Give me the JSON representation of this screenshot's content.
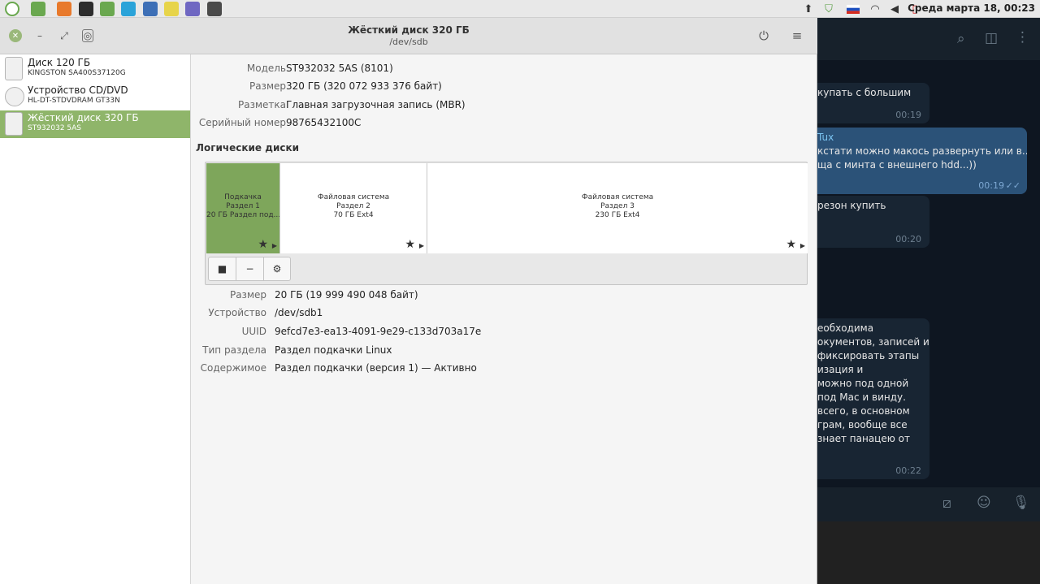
{
  "panel": {
    "clock": "Среда марта 18, 00:23",
    "launchers": [
      {
        "name": "menu-icon",
        "color": "#ffffff"
      },
      {
        "name": "files-icon",
        "color": "#6aa84f"
      },
      {
        "name": "firefox-icon",
        "color": "#e8792b"
      },
      {
        "name": "terminal-icon",
        "color": "#2d2d2d"
      },
      {
        "name": "folder-icon",
        "color": "#6aa84f"
      },
      {
        "name": "telegram-icon",
        "color": "#2aa3d9"
      },
      {
        "name": "camera-icon",
        "color": "#3d6fb6"
      },
      {
        "name": "notes-icon",
        "color": "#e7d44a"
      },
      {
        "name": "calendar-icon",
        "color": "#6f67c2"
      },
      {
        "name": "disks-icon",
        "color": "#4a4a4a"
      }
    ]
  },
  "window": {
    "title": "Жёсткий диск 320 ГБ",
    "subtitle": "/dev/sdb",
    "power_icon": "⏻",
    "menu_icon": "≡"
  },
  "sidebar": {
    "devices": [
      {
        "name": "Диск 120 ГБ",
        "sub": "KINGSTON SA400S37120G",
        "type": "disk"
      },
      {
        "name": "Устройство CD/DVD",
        "sub": "HL-DT-STDVDRAM GT33N",
        "type": "cd"
      },
      {
        "name": "Жёсткий диск 320 ГБ",
        "sub": "ST932032 5AS",
        "type": "disk"
      }
    ]
  },
  "disk": {
    "props": [
      {
        "key": "Модель",
        "value": "ST932032 5AS (8101)"
      },
      {
        "key": "Размер",
        "value": "320 ГБ (320 072 933 376 байт)"
      },
      {
        "key": "Разметка",
        "value": "Главная загрузочная запись (MBR)"
      },
      {
        "key": "Серийный номер",
        "value": "98765432100C"
      }
    ],
    "section": "Логические диски",
    "partitions": [
      {
        "line1": "Подкачка",
        "line2": "Раздел 1",
        "line3": "20 ГБ Раздел под..."
      },
      {
        "line1": "Файловая система",
        "line2": "Раздел 2",
        "line3": "70 ГБ Ext4"
      },
      {
        "line1": "Файловая система",
        "line2": "Раздел 3",
        "line3": "230 ГБ Ext4"
      }
    ],
    "tools": [
      "■",
      "−",
      "⚙"
    ]
  },
  "volume": {
    "props": [
      {
        "key": "Размер",
        "value": "20 ГБ (19 999 490 048 байт)"
      },
      {
        "key": "Устройство",
        "value": "/dev/sdb1"
      },
      {
        "key": "UUID",
        "value": "9efcd7e3-ea13-4091-9e29-c133d703a17e"
      },
      {
        "key": "Тип раздела",
        "value": "Раздел подкачки Linux"
      },
      {
        "key": "Содержимое",
        "value": "Раздел подкачки (версия 1) — Активно"
      }
    ]
  },
  "telegram": {
    "messages": [
      {
        "lines": [
          "купать с большим"
        ],
        "time": "00:19",
        "out": false
      },
      {
        "lines": [
          "Tux",
          "кстати можно макось развернуть или в...",
          "ща с минта с внешнего hdd...))"
        ],
        "time": "00:19",
        "out": true
      },
      {
        "lines": [
          "резон купить"
        ],
        "time": "00:20",
        "out": false
      },
      {
        "lines": [
          "еобходима",
          "окументов, записей и",
          "фиксировать этапы",
          "изация и",
          "можно под одной",
          "под Мас и винду.",
          "всего, в основном",
          "грам, вообще все",
          "знает панацею от"
        ],
        "time": "00:22",
        "out": false
      }
    ]
  }
}
